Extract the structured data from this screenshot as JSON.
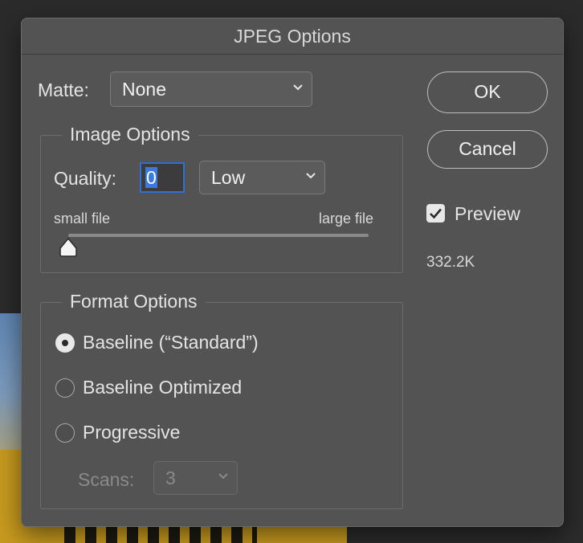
{
  "dialog": {
    "title": "JPEG Options"
  },
  "matte": {
    "label": "Matte:",
    "value": "None"
  },
  "image_options": {
    "title": "Image Options",
    "quality_label": "Quality:",
    "quality_value": "0",
    "quality_preset": "Low",
    "slider_min_label": "small file",
    "slider_max_label": "large file",
    "slider_value": 0
  },
  "format_options": {
    "title": "Format Options",
    "options": [
      {
        "label": "Baseline (“Standard”)",
        "selected": true
      },
      {
        "label": "Baseline Optimized",
        "selected": false
      },
      {
        "label": "Progressive",
        "selected": false
      }
    ],
    "scans_label": "Scans:",
    "scans_value": "3"
  },
  "buttons": {
    "ok": "OK",
    "cancel": "Cancel"
  },
  "preview": {
    "label": "Preview",
    "checked": true,
    "file_size": "332.2K"
  },
  "colors": {
    "dialog_bg": "#535353",
    "focus_blue": "#2f6fd6",
    "text": "#e6e6e6"
  }
}
